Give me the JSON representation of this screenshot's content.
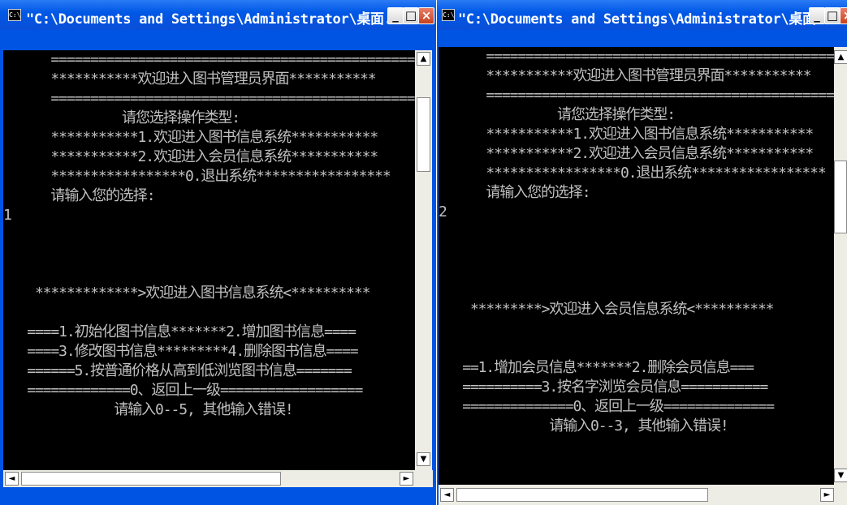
{
  "windows": [
    {
      "title": "\"C:\\Documents and Settings\\Administrator\\桌面...",
      "lines": [
        "      ==============================================",
        "      ***********欢迎进入图书管理员界面***********",
        "      ==============================================",
        "               请您选择操作类型:",
        "      ***********1.欢迎进入图书信息系统***********",
        "      ***********2.欢迎进入会员信息系统***********",
        "      *****************0.退出系统*****************",
        "      请输入您的选择:",
        "1",
        "",
        "",
        "",
        "    *************>欢迎进入图书信息系统<**********",
        "",
        "   ====1.初始化图书信息*******2.增加图书信息====",
        "   ====3.修改图书信息*********4.删除图书信息====",
        "   ======5.按普通价格从高到低浏览图书信息=======",
        "   =============0、返回上一级==================",
        "              请输入0--5, 其他输入错误!"
      ]
    },
    {
      "title": "\"C:\\Documents and Settings\\Administrator\\桌面...",
      "lines": [
        "      ==============================================",
        "      ***********欢迎进入图书管理员界面***********",
        "      ==============================================",
        "               请您选择操作类型:",
        "      ***********1.欢迎进入图书信息系统***********",
        "      ***********2.欢迎进入会员信息系统***********",
        "      *****************0.退出系统*****************",
        "      请输入您的选择:",
        "2",
        "",
        "",
        "",
        "",
        "    *********>欢迎进入会员信息系统<**********",
        "",
        "",
        "   ==1.增加会员信息*******2.删除会员信息===",
        "   ==========3.按名字浏览会员信息===========",
        "   ==============0、返回上一级==============",
        "              请输入0--3, 其他输入错误!"
      ]
    }
  ],
  "icons": {
    "app": "console-icon",
    "minimize": "minimize-icon",
    "maximize": "maximize-icon",
    "close": "close-icon"
  }
}
